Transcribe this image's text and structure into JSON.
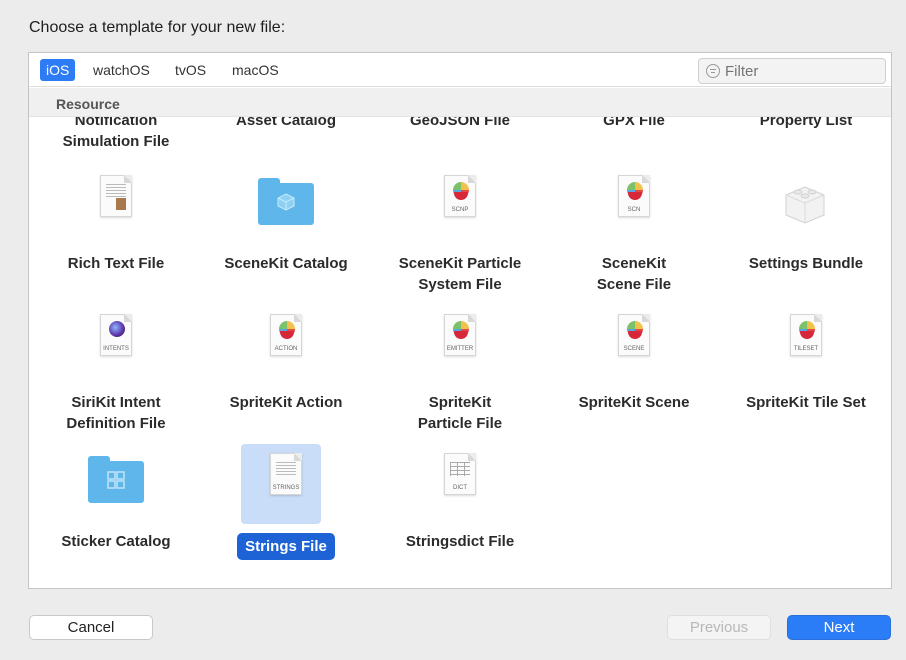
{
  "dialog": {
    "heading": "Choose a template for your new file:"
  },
  "tabs": [
    {
      "label": "iOS",
      "selected": true
    },
    {
      "label": "watchOS"
    },
    {
      "label": "tvOS"
    },
    {
      "label": "macOS"
    }
  ],
  "filter": {
    "placeholder": "Filter"
  },
  "section": {
    "title": "Resource"
  },
  "row0": [
    "Notification\nSimulation File",
    "Asset Catalog",
    "GeoJSON File",
    "GPX File",
    "Property List"
  ],
  "templates": [
    {
      "label": "Rich Text File",
      "icon": "rich-text-file-icon",
      "tag": ""
    },
    {
      "label": "SceneKit Catalog",
      "icon": "scenekit-catalog-folder-icon",
      "tag": ""
    },
    {
      "label": "SceneKit Particle\nSystem File",
      "icon": "scenekit-particle-icon",
      "tag": "SCNP"
    },
    {
      "label": "SceneKit\nScene File",
      "icon": "scenekit-scene-icon",
      "tag": "SCN"
    },
    {
      "label": "Settings Bundle",
      "icon": "settings-bundle-icon",
      "tag": ""
    },
    {
      "label": "SiriKit Intent\nDefinition File",
      "icon": "intents-file-icon",
      "tag": "INTENTS"
    },
    {
      "label": "SpriteKit Action",
      "icon": "spritekit-action-icon",
      "tag": "ACTION"
    },
    {
      "label": "SpriteKit\nParticle File",
      "icon": "spritekit-particle-icon",
      "tag": "EMITTER"
    },
    {
      "label": "SpriteKit Scene",
      "icon": "spritekit-scene-icon",
      "tag": "SCENE"
    },
    {
      "label": "SpriteKit Tile Set",
      "icon": "spritekit-tileset-icon",
      "tag": "TILESET"
    },
    {
      "label": "Sticker Catalog",
      "icon": "sticker-catalog-folder-icon",
      "tag": ""
    },
    {
      "label": "Strings File",
      "icon": "strings-file-icon",
      "tag": "STRINGS",
      "selected": true
    },
    {
      "label": "Stringsdict File",
      "icon": "stringsdict-file-icon",
      "tag": "DICT"
    }
  ],
  "buttons": {
    "cancel": "Cancel",
    "previous": "Previous",
    "next": "Next"
  },
  "colors": {
    "accent": "#2b7df7",
    "selection": "#1e63d6",
    "folder": "#5fb6ea"
  }
}
